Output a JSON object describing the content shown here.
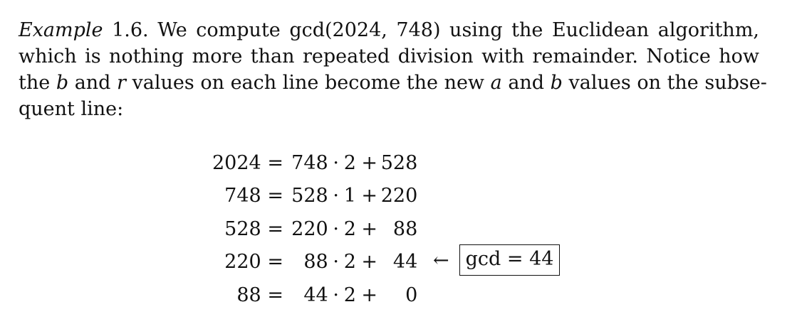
{
  "paragraph": {
    "example_label": "Example",
    "line1_rest": " 1.6. We compute gcd(2024, 748) using the Euclidean algorithm,",
    "line2": "which is nothing more than repeated division with remainder. Notice how",
    "line3_a": "the ",
    "var_b": "b",
    "line3_b": " and ",
    "var_r": "r",
    "line3_c": " values on each line become the new ",
    "var_a": "a",
    "line3_d": " and ",
    "var_b2": "b",
    "line3_e": " values on the subse-",
    "line4": "quent line:"
  },
  "equations": [
    {
      "a": "2024",
      "eq": "=",
      "b": "748",
      "dot": "·",
      "q": "2",
      "plus": "+",
      "r": "528"
    },
    {
      "a": "748",
      "eq": "=",
      "b": "528",
      "dot": "·",
      "q": "1",
      "plus": "+",
      "r": "220"
    },
    {
      "a": "528",
      "eq": "=",
      "b": "220",
      "dot": "·",
      "q": "2",
      "plus": "+",
      "r": "88"
    },
    {
      "a": "220",
      "eq": "=",
      "b": "88",
      "dot": "·",
      "q": "2",
      "plus": "+",
      "r": "44"
    },
    {
      "a": "88",
      "eq": "=",
      "b": "44",
      "dot": "·",
      "q": "2",
      "plus": "+",
      "r": "0"
    }
  ],
  "note": {
    "arrow": "←",
    "result": "gcd = 44"
  }
}
